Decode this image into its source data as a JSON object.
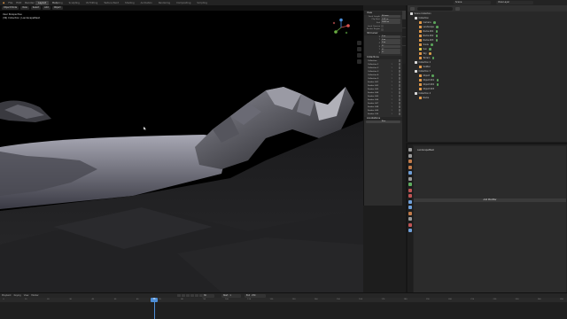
{
  "topbar": {
    "menus": [
      "File",
      "Edit",
      "Render",
      "Window",
      "Help"
    ],
    "workspaces": [
      "Layout",
      "Modeling",
      "Sculpting",
      "UV Editing",
      "Texture Paint",
      "Shading",
      "Animation",
      "Rendering",
      "Compositing",
      "Scripting"
    ],
    "active_workspace_index": 0,
    "scene": "Scene",
    "view_layer": "View Layer"
  },
  "viewport": {
    "header_buttons": [
      "Object Mode",
      "View",
      "Select",
      "Add",
      "Object"
    ],
    "info_line1": "User Perspective",
    "info_line2": "(36) Collection | LandscapeMesh",
    "background": "#000000"
  },
  "npanel": {
    "sections": {
      "view": "View",
      "view3d_cursor": "3D Cursor",
      "collections": "Collections",
      "annotations": "Annotations"
    },
    "fields": [
      {
        "label": "Focal Length",
        "value": "50 mm"
      },
      {
        "label": "Clip Start",
        "value": "0.01 m"
      },
      {
        "label": "End",
        "value": "1000 m"
      },
      {
        "label": "Local Camera",
        "value": ""
      },
      {
        "label": "Render Region",
        "value": ""
      }
    ],
    "cursor_fields": [
      {
        "label": "X",
        "value": "0 m"
      },
      {
        "label": "Y",
        "value": "0 m"
      },
      {
        "label": "Z",
        "value": "0 m"
      }
    ],
    "rotation_fields": [
      {
        "label": "X",
        "value": "0°"
      },
      {
        "label": "Y",
        "value": "0°"
      },
      {
        "label": "Z",
        "value": "0°"
      }
    ],
    "collections": [
      {
        "name": "Collection",
        "count": ""
      },
      {
        "name": "Collection 1",
        "count": "1"
      },
      {
        "name": "Collection 2",
        "count": "1"
      },
      {
        "name": "Collection 3",
        "count": "1"
      },
      {
        "name": "Collection 4",
        "count": "1"
      },
      {
        "name": "Collection 5",
        "count": "1"
      },
      {
        "name": "Scatter 001",
        "count": "1"
      },
      {
        "name": "Scatter 002",
        "count": "1"
      },
      {
        "name": "Scatter 003",
        "count": "1"
      },
      {
        "name": "Scatter 004",
        "count": "1"
      },
      {
        "name": "Scatter 005",
        "count": "1"
      },
      {
        "name": "Scatter 006",
        "count": "1"
      },
      {
        "name": "Scatter 007",
        "count": "1"
      },
      {
        "name": "Scatter 008",
        "count": "1"
      },
      {
        "name": "Scatter 009",
        "count": "1"
      },
      {
        "name": "Scatter 010",
        "count": "1"
      }
    ],
    "new_note_button": "New"
  },
  "outliner": {
    "items": [
      {
        "name": "Scene Collection",
        "indent": 0,
        "icon_color": "#d9d9d9",
        "tag": ""
      },
      {
        "name": "Collection",
        "indent": 1,
        "icon_color": "#d9d9d9",
        "tag": ""
      },
      {
        "name": "Camera",
        "indent": 2,
        "icon_color": "#e39a4a",
        "tag": "#5aa35a"
      },
      {
        "name": "Landscape",
        "indent": 2,
        "icon_color": "#e39a4a",
        "tag": "#5aa35a"
      },
      {
        "name": "Rocks.001",
        "indent": 2,
        "icon_color": "#e39a4a",
        "tag": "#5aa35a"
      },
      {
        "name": "Rocks.002",
        "indent": 2,
        "icon_color": "#e39a4a",
        "tag": "#5aa35a"
      },
      {
        "name": "Rocks.003",
        "indent": 2,
        "icon_color": "#e39a4a",
        "tag": "#5aa35a"
      },
      {
        "name": "Snow",
        "indent": 2,
        "icon_color": "#e39a4a",
        "tag": "#5aa35a"
      },
      {
        "name": "Sun",
        "indent": 2,
        "icon_color": "#e3c74a",
        "tag": "#5aa35a"
      },
      {
        "name": "Sky",
        "indent": 2,
        "icon_color": "#e39a4a",
        "tag": "#d4a04a"
      },
      {
        "name": "Terrain",
        "indent": 2,
        "icon_color": "#e39a4a",
        "tag": "#5aa35a"
      },
      {
        "name": "Collection 2",
        "indent": 1,
        "icon_color": "#d9d9d9",
        "tag": ""
      },
      {
        "name": "Scatter",
        "indent": 2,
        "icon_color": "#e39a4a",
        "tag": ""
      },
      {
        "name": "Collection 3",
        "indent": 1,
        "icon_color": "#d9d9d9",
        "tag": ""
      },
      {
        "name": "Object",
        "indent": 2,
        "icon_color": "#e39a4a",
        "tag": "#5aa35a"
      },
      {
        "name": "Object.001",
        "indent": 2,
        "icon_color": "#e39a4a",
        "tag": "#5aa35a"
      },
      {
        "name": "Object.002",
        "indent": 2,
        "icon_color": "#e39a4a",
        "tag": "#5aa35a"
      },
      {
        "name": "Object.003",
        "indent": 2,
        "icon_color": "#e39a4a",
        "tag": ""
      },
      {
        "name": "Collection 4",
        "indent": 1,
        "icon_color": "#d9d9d9",
        "tag": ""
      },
      {
        "name": "Rocks",
        "indent": 2,
        "icon_color": "#e39a4a",
        "tag": ""
      }
    ]
  },
  "properties": {
    "title": "LandscapeMesh",
    "add_modifier": "Add Modifier",
    "tab_colors": [
      "#9a9a9a",
      "#9a9a9a",
      "#c27b4a",
      "#c27b4a",
      "#6f9fd8",
      "#9a9a9a",
      "#5fae5f",
      "#c05555",
      "#c05555",
      "#6f9fd8",
      "#6f9fd8",
      "#c27b4a",
      "#9a9a9a",
      "#c05555",
      "#6f9fd8"
    ]
  },
  "timeline": {
    "menus": [
      "Playback",
      "Keying",
      "View",
      "Marker"
    ],
    "current_frame": "36",
    "start_label": "Start",
    "start": "1",
    "end_label": "End",
    "end": "250",
    "ticks": [
      "0",
      "10",
      "20",
      "30",
      "40",
      "50",
      "60",
      "70",
      "80",
      "90",
      "100",
      "110",
      "120",
      "130",
      "140",
      "150",
      "160",
      "170",
      "180",
      "190",
      "200",
      "210",
      "220",
      "230",
      "240",
      "250"
    ]
  }
}
